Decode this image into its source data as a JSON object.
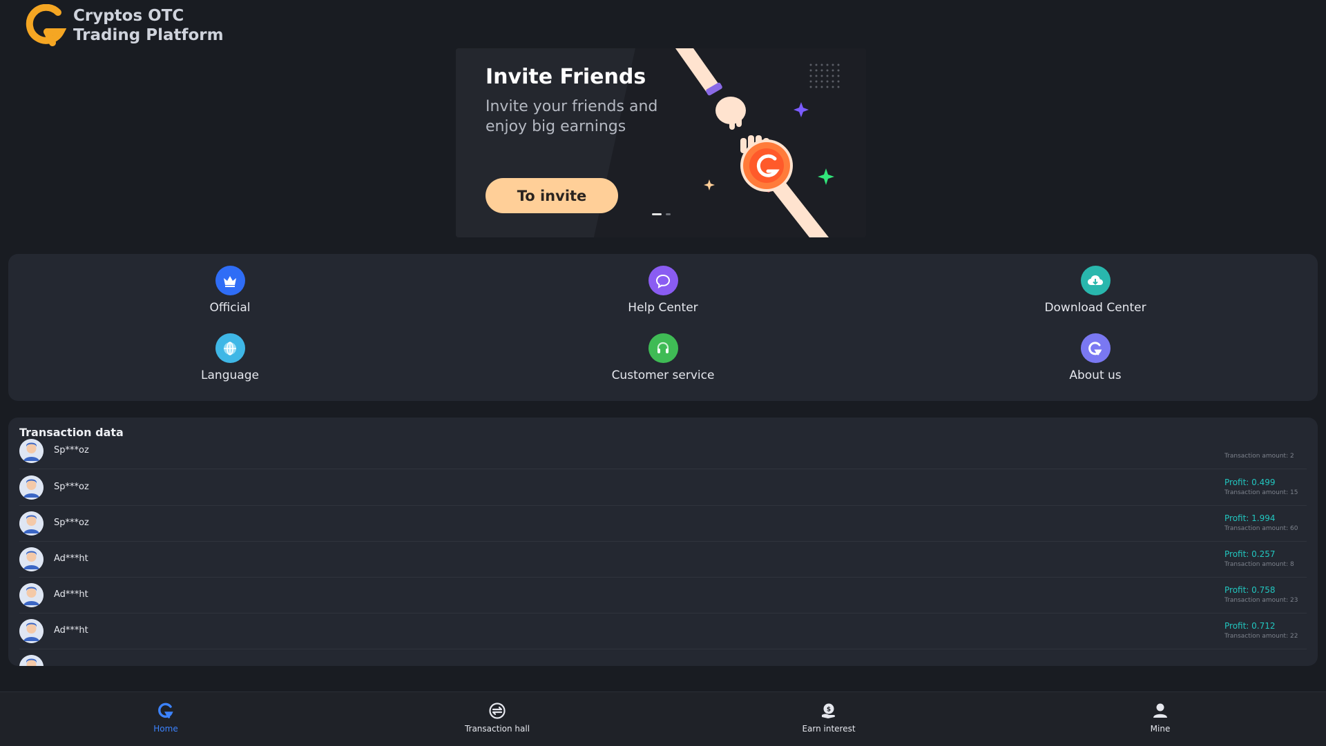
{
  "app": {
    "logo_line1": "Cryptos  OTC",
    "logo_line2": "Trading  Platform",
    "accent": "#f5a623"
  },
  "banner": {
    "title": "Invite Friends",
    "subtitle": "Invite your friends and enjoy big earnings",
    "button_label": "To invite",
    "slide_index": 1,
    "slide_count": 2
  },
  "menu": {
    "items": [
      {
        "label": "Official",
        "icon": "crown-icon",
        "color": "#2f6df6"
      },
      {
        "label": "Help Center",
        "icon": "chat-bubble-icon",
        "color": "#8a5cf2"
      },
      {
        "label": "Download Center",
        "icon": "cloud-download-icon",
        "color": "#29b7ad"
      },
      {
        "label": "Language",
        "icon": "globe-icon",
        "color": "#3fb7e6"
      },
      {
        "label": "Customer service",
        "icon": "headset-icon",
        "color": "#3fbb55"
      },
      {
        "label": "About us",
        "icon": "brand-g-icon",
        "color": "#7a78f2"
      }
    ]
  },
  "transactions": {
    "title": "Transaction data",
    "rows": [
      {
        "name": "Sp***oz",
        "profit": "",
        "amount": "Transaction amount: 2"
      },
      {
        "name": "Sp***oz",
        "profit": "Profit: 0.499",
        "amount": "Transaction amount: 15"
      },
      {
        "name": "Sp***oz",
        "profit": "Profit: 1.994",
        "amount": "Transaction amount: 60"
      },
      {
        "name": "Ad***ht",
        "profit": "Profit: 0.257",
        "amount": "Transaction amount: 8"
      },
      {
        "name": "Ad***ht",
        "profit": "Profit: 0.758",
        "amount": "Transaction amount: 23"
      },
      {
        "name": "Ad***ht",
        "profit": "Profit: 0.712",
        "amount": "Transaction amount: 22"
      },
      {
        "name": "",
        "profit": "",
        "amount": ""
      }
    ]
  },
  "nav": {
    "items": [
      {
        "label": "Home",
        "icon": "home-g-icon",
        "active": true
      },
      {
        "label": "Transaction hall",
        "icon": "exchange-icon",
        "active": false
      },
      {
        "label": "Earn interest",
        "icon": "earn-interest-icon",
        "active": false
      },
      {
        "label": "Mine",
        "icon": "user-icon",
        "active": false
      }
    ]
  }
}
